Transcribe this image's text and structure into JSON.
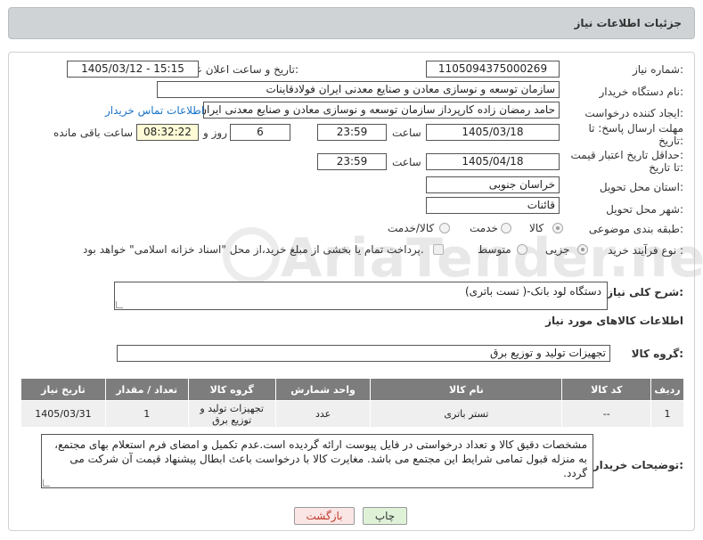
{
  "header": {
    "title": "جزئیات اطلاعات نیاز"
  },
  "form": {
    "need_number": {
      "label": "شماره نیاز:",
      "value": "1105094375000269"
    },
    "announce_datetime": {
      "label": "تاریخ و ساعت اعلان عمومی:",
      "value": "1405/03/12 - 15:15"
    },
    "buyer_org": {
      "label": "نام دستگاه خریدار:",
      "value": "سازمان توسعه و نوسازی معادن و صنایع معدنی ایران فولادقاینات"
    },
    "requester": {
      "label": "ایجاد کننده درخواست:",
      "value": "حامد  رمضان زاده  کارپرداز  سازمان توسعه و نوسازی معادن و صنایع معدنی ایران",
      "contact_link": "اطلاعات تماس خریدار"
    },
    "reply_deadline": {
      "label_line1": "مهلت ارسال پاسخ: تا",
      "label_line2": "تاریخ:",
      "date": "1405/03/18",
      "time_label": "ساعت",
      "time": "23:59",
      "days": "6",
      "days_label": "روز و",
      "remaining": "08:32:22",
      "remaining_label": "ساعت باقی مانده"
    },
    "price_validity": {
      "label_line1": "حداقل تاریخ اعتبار قیمت:",
      "label_line2": "تا تاریخ:",
      "date": "1405/04/18",
      "time_label": "ساعت",
      "time": "23:59"
    },
    "province": {
      "label": "استان محل تحویل:",
      "value": "خراسان جنوبی"
    },
    "city": {
      "label": "شهر محل تحویل:",
      "value": "قائنات"
    },
    "category": {
      "label": "طبقه بندی موضوعی:",
      "options": [
        "کالا",
        "خدمت",
        "کالا/خدمت"
      ],
      "selected": "کالا"
    },
    "purchase_process": {
      "label": "نوع فرآیند خرید :",
      "options": [
        "جزیی",
        "متوسط"
      ],
      "selected": "جزیی",
      "treasury_note": "پرداخت تمام یا بخشی از مبلغ خرید،از محل \"اسناد خزانه اسلامی\" خواهد بود."
    },
    "general_desc": {
      "label": "شرح کلی نیاز:",
      "value": "دستگاه لود بانک-( تست باتری)"
    },
    "goods_info_title": "اطلاعات کالاهای مورد نیاز",
    "goods_group": {
      "label": "گروه کالا:",
      "value": "تجهیزات تولید و توزیع برق"
    }
  },
  "table": {
    "headers": [
      "ردیف",
      "کد کالا",
      "نام کالا",
      "واحد شمارش",
      "گروه کالا",
      "تعداد / مقدار",
      "تاریخ نیاز"
    ],
    "rows": [
      [
        "1",
        "--",
        "تستر باتری",
        "عدد",
        "تجهیزات تولید و توزیع برق",
        "1",
        "1405/03/31"
      ]
    ]
  },
  "buyer_notes": {
    "label": "توضیحات خریدار:",
    "value": "مشخصات دقیق کالا و تعداد درخواستی در فایل پیوست ارائه گردیده است.عدم تکمیل و امضای فرم استعلام بهای مجتمع، به منزله قبول تمامی شرایط این مجتمع می باشد. مغایرت کالا با درخواست باعث ابطال پیشنهاد قیمت آن شرکت می گردد."
  },
  "buttons": {
    "print": "چاپ",
    "back": "بازگشت"
  },
  "watermark": "AriaTender.net"
}
